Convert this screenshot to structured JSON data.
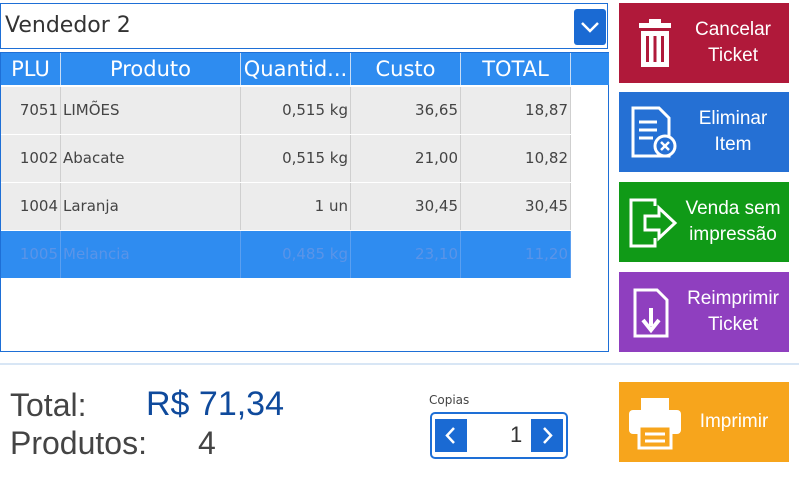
{
  "seller": {
    "selected": "Vendedor 2"
  },
  "table": {
    "headers": [
      "PLU",
      "Produto",
      "Quantid...",
      "Custo",
      "TOTAL"
    ],
    "rows": [
      {
        "plu": "7051",
        "produto": "LIMÕES",
        "quantidade": "0,515 kg",
        "custo": "36,65",
        "total": "18,87"
      },
      {
        "plu": "1002",
        "produto": "Abacate",
        "quantidade": "0,515 kg",
        "custo": "21,00",
        "total": "10,82"
      },
      {
        "plu": "1004",
        "produto": "Laranja",
        "quantidade": "1 un",
        "custo": "30,45",
        "total": "30,45"
      },
      {
        "plu": "1005",
        "produto": "Melancia",
        "quantidade": "0,485 kg",
        "custo": "23,10",
        "total": "11,20"
      }
    ],
    "selected_row": 3
  },
  "actions": {
    "cancel": "Cancelar Ticket",
    "delete_item": "Eliminar Item",
    "sell_no_print": "Venda sem impressão",
    "reprint": "Reimprimir Ticket",
    "print": "Imprimir"
  },
  "summary": {
    "total_label": "Total:",
    "total_value": "R$ 71,34",
    "products_label": "Produtos:",
    "products_value": "4"
  },
  "copies": {
    "label": "Copias",
    "value": "1"
  },
  "colors": {
    "primary": "#1a6ad3",
    "header": "#2e8cf0",
    "selected_row": "#2f8cf0",
    "cancel": "#b0193a",
    "delete": "#2570d4",
    "sell": "#109a17",
    "reprint": "#8f3fbf",
    "print": "#f7a51c"
  }
}
